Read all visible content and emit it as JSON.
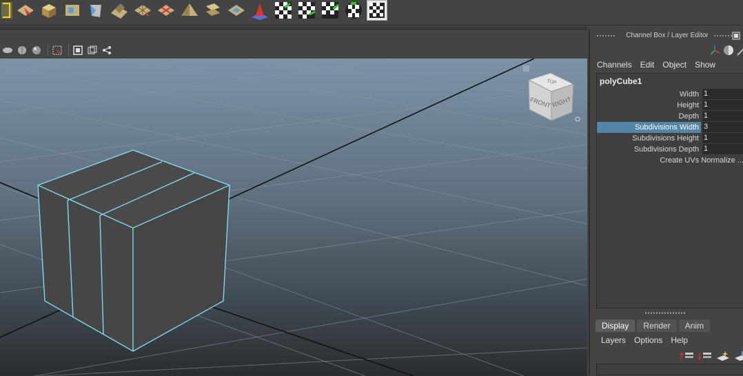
{
  "shelf": {
    "icons": [
      "uv-layout-icon",
      "uv-select-icon",
      "uv-box-icon",
      "uv-planar-icon",
      "uv-prism-icon",
      "uv-unfold-icon",
      "uv-grid-select-icon",
      "uv-cut-icon",
      "uv-pyramid-icon",
      "uv-stack-icon",
      "uv-tile-icon",
      "uv-lamp-icon",
      "checker-arrow-icon",
      "checker-arrow2-icon",
      "checker-arrow3-icon",
      "checker-globe-icon",
      "checker-grid-icon"
    ]
  },
  "viewport": {
    "toolbar_icons": [
      "smooth-shade-icon",
      "wireframe-shade-icon",
      "textured-icon",
      "select-region-icon",
      "isolate-icon",
      "xray-icon",
      "share-icon"
    ],
    "view_cube": {
      "top": "TOP",
      "front": "FRONT",
      "right": "RIGHT"
    }
  },
  "dock": {
    "title": "Channel Box / Layer Editor",
    "channel_menu": [
      "Channels",
      "Edit",
      "Object",
      "Show"
    ],
    "object_name": "polyCube1",
    "attributes": [
      {
        "label": "Width",
        "value": "1",
        "selected": false
      },
      {
        "label": "Height",
        "value": "1",
        "selected": false
      },
      {
        "label": "Depth",
        "value": "1",
        "selected": false
      },
      {
        "label": "Subdivisions Width",
        "value": "3",
        "selected": true
      },
      {
        "label": "Subdivisions Height",
        "value": "1",
        "selected": false
      },
      {
        "label": "Subdivisions Depth",
        "value": "1",
        "selected": false
      }
    ],
    "extra_attribute": "Create UVs Normalize ...",
    "layer_tabs": [
      "Display",
      "Render",
      "Anim"
    ],
    "active_tab": "Display",
    "layer_menu": [
      "Layers",
      "Options",
      "Help"
    ]
  },
  "colors": {
    "highlight": "#5285a6",
    "wire": "#7fd8f0",
    "sky_top": "#7c93a8",
    "ground_bottom": "#2a2d30"
  }
}
